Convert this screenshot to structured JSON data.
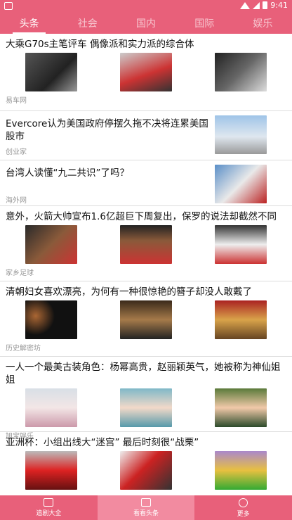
{
  "status": {
    "time": "9:41"
  },
  "tabs": [
    {
      "label": "头条"
    },
    {
      "label": "社会"
    },
    {
      "label": "国内"
    },
    {
      "label": "国际"
    },
    {
      "label": "娱乐"
    }
  ],
  "articles": [
    {
      "title": "大乘G70s主笔评车 偶像派和实力派的综合体",
      "source": "易车网"
    },
    {
      "title": " Evercore认为美国政府停摆久拖不决将连累美国股市",
      "source": "创业家"
    },
    {
      "title": "台湾人读懂“九二共识”了吗？",
      "source": "海外网"
    },
    {
      "title": "意外，火箭大帅宣布1.6亿超巨下周复出，保罗的说法却截然不同",
      "source": "家乡足球"
    },
    {
      "title": "清朝妇女喜欢漂亮，为何有一种很惊艳的簪子却没人敢戴了",
      "source": "历史解密坊"
    },
    {
      "title": "一人一个最美古装角色：杨幂高贵，赵丽颖英气，她被称为神仙姐姐",
      "source": "旭宝娱乐"
    },
    {
      "title": "亚洲杯：小组出线大“迷宫” 最后时刻很“战栗”",
      "source": ""
    }
  ],
  "bottom_nav": [
    {
      "label": "追剧大全",
      "icon": "tv-icon"
    },
    {
      "label": "看看头条",
      "icon": "news-icon"
    },
    {
      "label": "更多",
      "icon": "more-icon"
    }
  ]
}
